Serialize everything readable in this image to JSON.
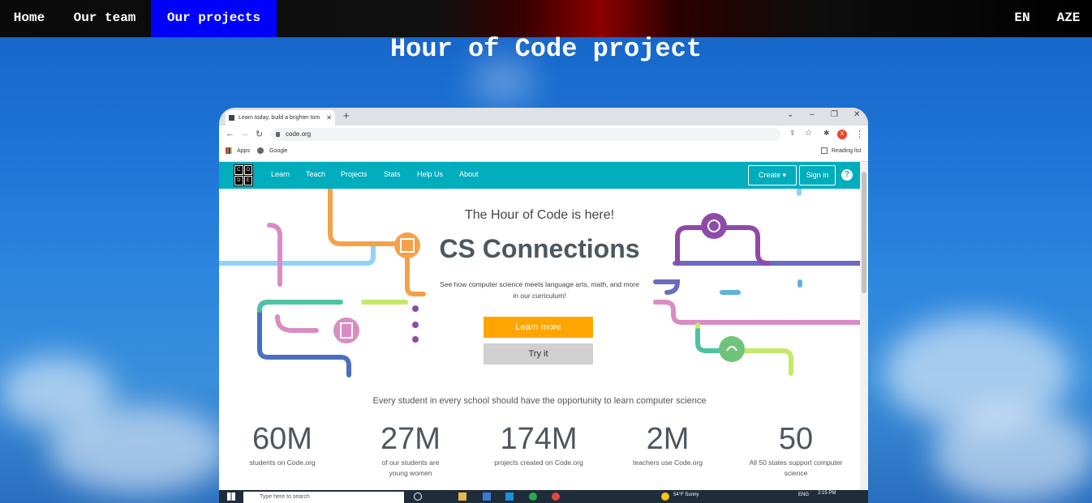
{
  "nav": {
    "items": [
      {
        "label": "Home"
      },
      {
        "label": "Our team"
      },
      {
        "label": "Our projects",
        "active": true
      }
    ],
    "lang": [
      "EN",
      "AZE"
    ]
  },
  "page": {
    "title": "Hour of Code project"
  },
  "browser": {
    "tab_title": "Learn today, build a brighter tom",
    "url": "code.org",
    "bookmarks": [
      "Apps",
      "Google"
    ],
    "reading_list": "Reading list",
    "profile_initial": "X"
  },
  "site": {
    "logo_letters": [
      "C",
      "O",
      "D",
      "E"
    ],
    "links": [
      "Learn",
      "Teach",
      "Projects",
      "Stats",
      "Help Us",
      "About"
    ],
    "create_label": "Create ▾",
    "signin_label": "Sign in",
    "help": "?",
    "hero_sub": "The Hour of Code is here!",
    "hero_title": "CS Connections",
    "hero_desc": "See how computer science meets language arts, math, and more in our curriculum!",
    "learn_more": "Learn more",
    "try_it": "Try it",
    "tagline": "Every student in every school should have the opportunity to learn computer science",
    "stats": [
      {
        "num": "60M",
        "label": "students on Code.org"
      },
      {
        "num": "27M",
        "label": "of our students are young women"
      },
      {
        "num": "174M",
        "label": "projects created on Code.org"
      },
      {
        "num": "2M",
        "label": "teachers use Code.org"
      },
      {
        "num": "50",
        "label": "All 50 states support computer science"
      }
    ]
  },
  "taskbar": {
    "search": "Type here to search",
    "weather": "54°F  Sunny",
    "lang": "ENG",
    "time": "2:15 PM"
  }
}
